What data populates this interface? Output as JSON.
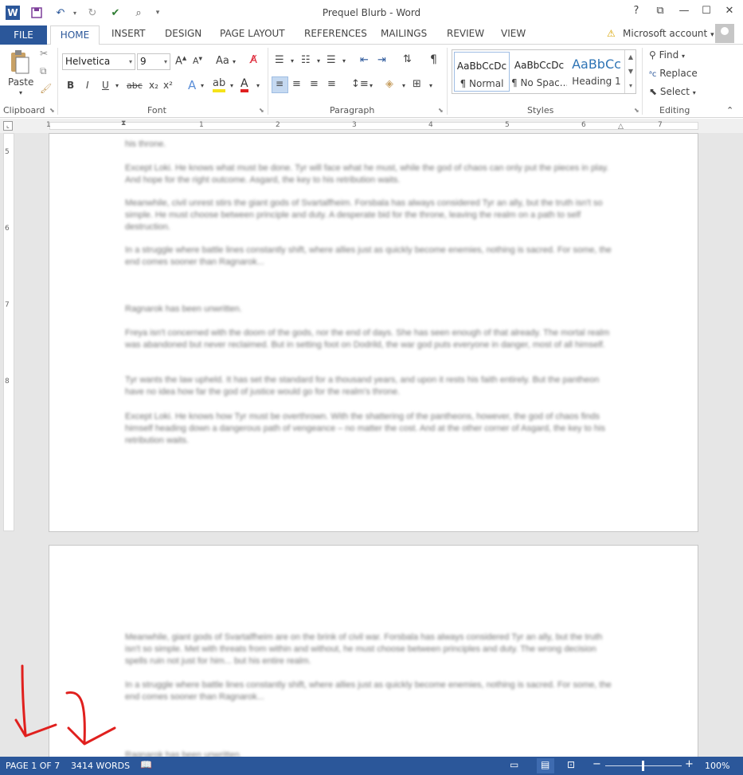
{
  "window": {
    "title": "Prequel Blurb - Word",
    "help": "?"
  },
  "tabs": [
    "FILE",
    "HOME",
    "INSERT",
    "DESIGN",
    "PAGE LAYOUT",
    "REFERENCES",
    "MAILINGS",
    "REVIEW",
    "VIEW"
  ],
  "account": {
    "label": "Microsoft account"
  },
  "clipboard": {
    "paste": "Paste",
    "group": "Clipboard"
  },
  "font": {
    "family": "Helvetica",
    "size": "9",
    "group": "Font",
    "bold": "B",
    "italic": "I",
    "underline": "U",
    "strike": "abc",
    "sub": "x₂",
    "sup": "x²"
  },
  "paragraph": {
    "group": "Paragraph"
  },
  "styles": {
    "group": "Styles",
    "items": [
      {
        "sample": "AaBbCcDc",
        "name": "¶ Normal"
      },
      {
        "sample": "AaBbCcDc",
        "name": "¶ No Spac..."
      },
      {
        "sample": "AaBbCc",
        "name": "Heading 1"
      }
    ]
  },
  "editing": {
    "group": "Editing",
    "find": "Find",
    "replace": "Replace",
    "select": "Select"
  },
  "ruler": {
    "numbers": [
      "1",
      "1",
      "2",
      "3",
      "4",
      "5",
      "6",
      "7"
    ]
  },
  "vruler": {
    "numbers": [
      "5",
      "6",
      "7",
      "8"
    ]
  },
  "page1": {
    "p0": "his throne.",
    "p1": "Except Loki. He knows what must be done. Tyr will face what he must, while the god of chaos can only put the pieces in play. And hope for the right outcome. Asgard, the key to his retribution waits.",
    "p2": "Meanwhile, civil unrest stirs the giant gods of Svartalfheim. Forsbala has always considered Tyr an ally, but the truth isn't so simple. He must choose between principle and duty. A desperate bid for the throne, leaving the realm on a path to self destruction.",
    "p3": "In a struggle where battle lines constantly shift, where allies just as quickly become enemies, nothing is sacred. For some, the end comes sooner than Ragnarok...",
    "p4": "Ragnarok has been unwritten.",
    "p5": "Freya isn't concerned with the doom of the gods, nor the end of days. She has seen enough of that already. The mortal realm was abandoned but never reclaimed. But in setting foot on Dodrild, the war god puts everyone in danger, most of all himself.",
    "p6": "Tyr wants the law upheld. It has set the standard for a thousand years, and upon it rests his faith entirely. But the pantheon have no idea how far the god of justice would go for the realm's throne.",
    "p7": "Except Loki. He knows how Tyr must be overthrown. With the shattering of the pantheons, however, the god of chaos finds himself heading down a dangerous path of vengeance – no matter the cost. And at the other corner of Asgard, the key to his retribution waits."
  },
  "page2": {
    "p1": "Meanwhile, giant gods of Svartalfheim are on the brink of civil war. Forsbala has always considered Tyr an ally, but the truth isn't so simple. Met with threats from within and without, he must choose between principles and duty. The wrong decision spells ruin not just for him... but his entire realm.",
    "p2": "In a struggle where battle lines constantly shift, where allies just as quickly become enemies, nothing is sacred. For some, the end comes sooner than Ragnarok...",
    "p3": "Ragnarok has been unwritten."
  },
  "status": {
    "page": "PAGE 1 OF 7",
    "words": "3414 WORDS",
    "zoom": "100%"
  },
  "colors": {
    "accent": "#2b579a",
    "annotation": "#e0201e"
  }
}
